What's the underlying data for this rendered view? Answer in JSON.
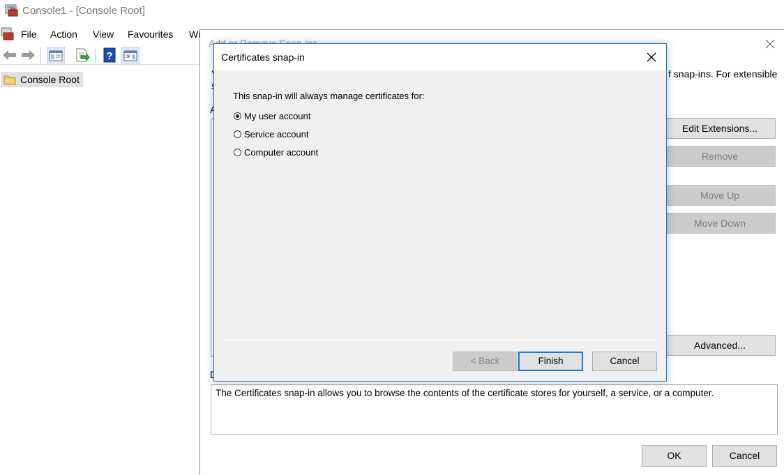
{
  "window": {
    "title": "Console1 - [Console Root]",
    "menu": [
      "File",
      "Action",
      "View",
      "Favourites",
      "Wi"
    ]
  },
  "toolbar": {
    "icons": [
      "back-arrow-icon",
      "forward-arrow-icon",
      "show-hide-console-tree-icon",
      "export-list-icon",
      "help-icon",
      "show-hide-action-pane-icon"
    ]
  },
  "tree": {
    "root_label": "Console Root"
  },
  "snapins_dialog": {
    "title": "Add or Remove Snap-ins",
    "description_visible": "f snap-ins. For extensible",
    "cut_letters": [
      "Y",
      "s",
      "A",
      "D"
    ],
    "buttons": {
      "edit_extensions": "Edit Extensions...",
      "remove": "Remove",
      "move_up": "Move Up",
      "move_down": "Move Down",
      "advanced": "Advanced..."
    },
    "description_box": "The Certificates snap-in allows you to browse the contents of the certificate stores for yourself, a service, or a computer.",
    "ok": "OK",
    "cancel": "Cancel"
  },
  "cert_dialog": {
    "title": "Certificates snap-in",
    "prompt": "This snap-in will always manage certificates for:",
    "options": [
      {
        "label": "My user account",
        "checked": true
      },
      {
        "label": "Service account",
        "checked": false
      },
      {
        "label": "Computer account",
        "checked": false
      }
    ],
    "back": "< Back",
    "finish": "Finish",
    "cancel": "Cancel"
  },
  "colors": {
    "accent": "#1976d2",
    "button_face": "#e1e1e1",
    "disabled_button": "#cccccc",
    "dialog_bg": "#f0f0f0"
  }
}
